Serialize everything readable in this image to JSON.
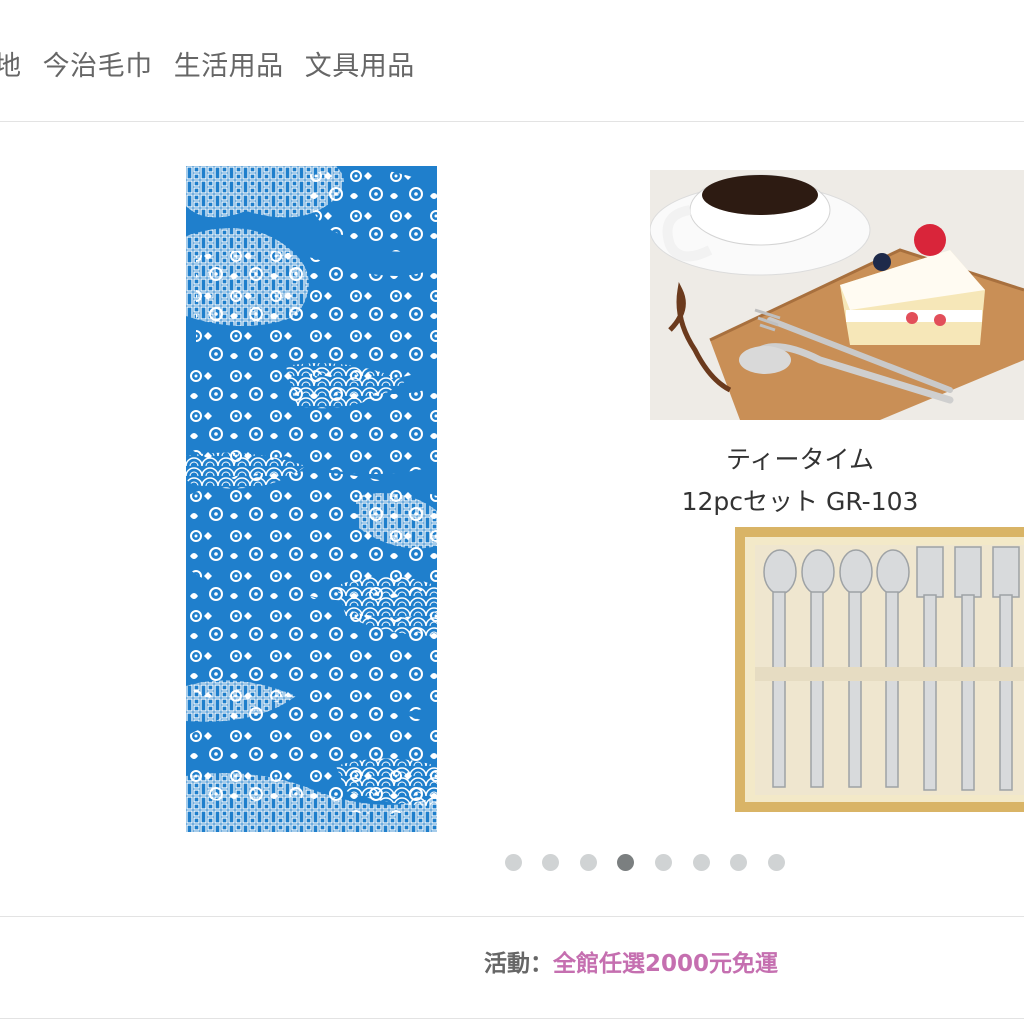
{
  "nav": {
    "items": [
      {
        "label": "地"
      },
      {
        "label": "今治毛巾"
      },
      {
        "label": "生活用品"
      },
      {
        "label": "文具用品"
      }
    ]
  },
  "slider": {
    "product_caption_line1": "ティータイム",
    "product_caption_line2": "12pcセット GR-103",
    "dots_count": 8,
    "active_dot_index": 3
  },
  "promo": {
    "label": "活動：",
    "link_text": "全館任選2000元免運"
  },
  "colors": {
    "towel_blue": "#1f7fcc",
    "promo_link": "#c56fb0",
    "dot_active": "#7b7f80",
    "dot_inactive": "#d0d3d4"
  }
}
